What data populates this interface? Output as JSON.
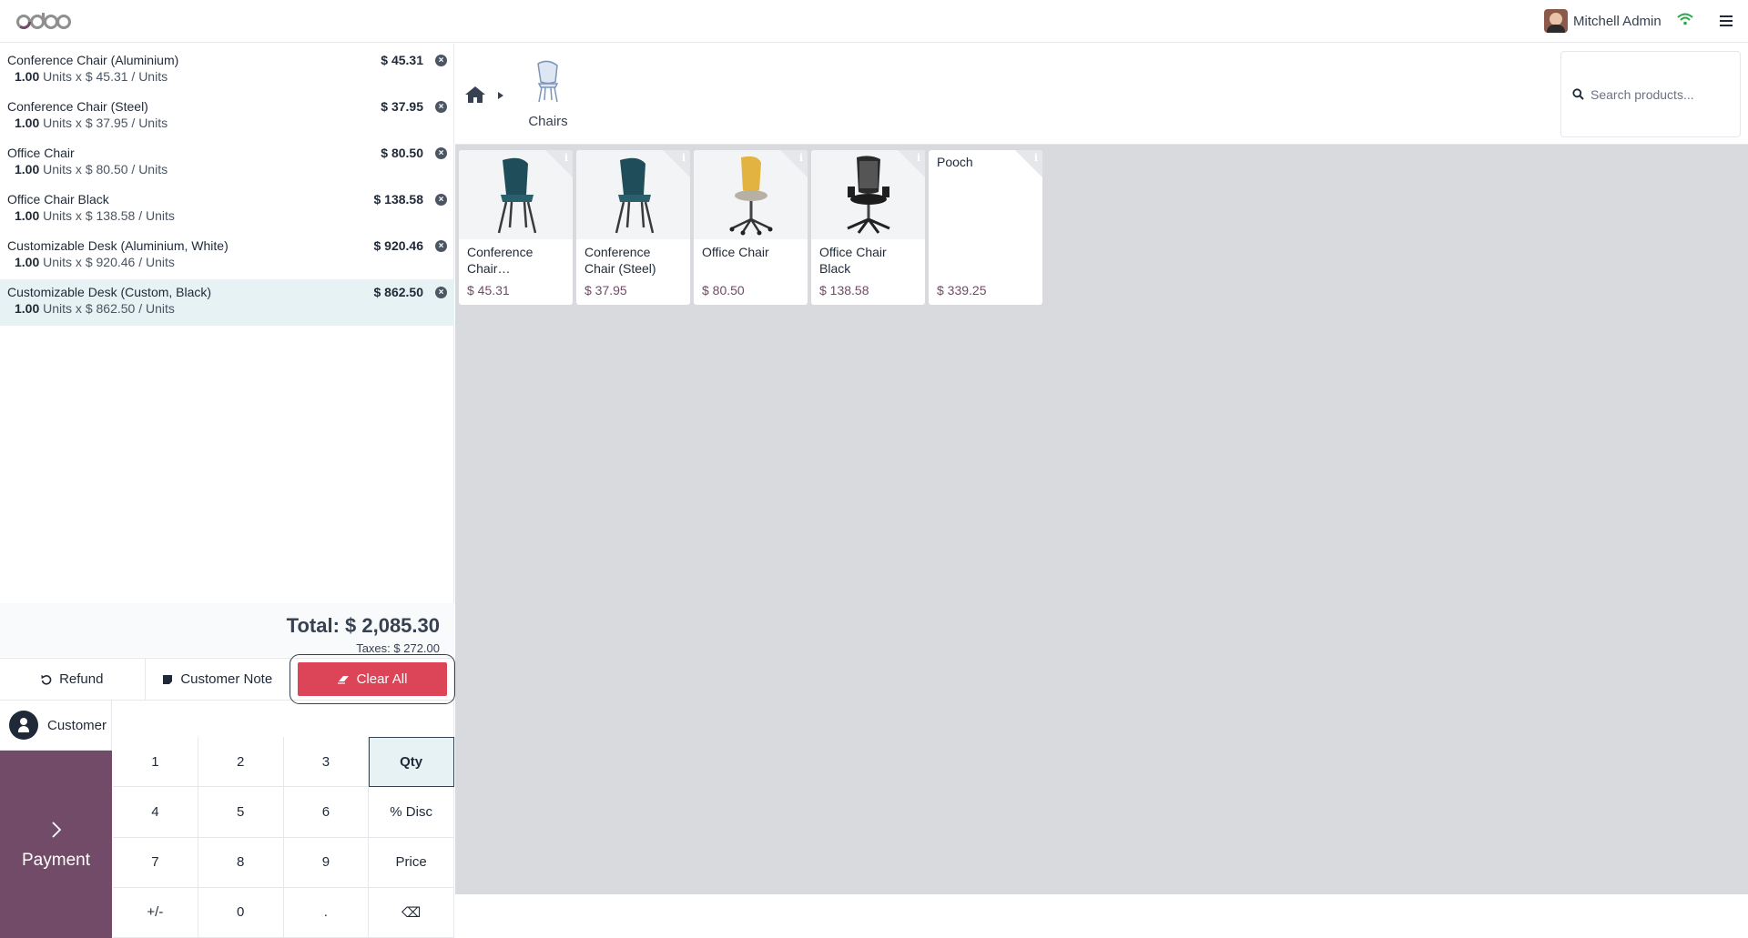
{
  "header": {
    "logo_text": "odoo",
    "user_name": "Mitchell Admin"
  },
  "order": {
    "lines": [
      {
        "name": "Conference Chair (Aluminium)",
        "price": "$ 45.31",
        "qty": "1.00",
        "detail": "Units x $ 45.31 / Units"
      },
      {
        "name": "Conference Chair (Steel)",
        "price": "$ 37.95",
        "qty": "1.00",
        "detail": "Units x $ 37.95 / Units"
      },
      {
        "name": "Office Chair",
        "price": "$ 80.50",
        "qty": "1.00",
        "detail": "Units x $ 80.50 / Units"
      },
      {
        "name": "Office Chair Black",
        "price": "$ 138.58",
        "qty": "1.00",
        "detail": "Units x $ 138.58 / Units"
      },
      {
        "name": "Customizable Desk (Aluminium, White)",
        "price": "$ 920.46",
        "qty": "1.00",
        "detail": "Units x $ 920.46 / Units"
      },
      {
        "name": "Customizable Desk (Custom, Black)",
        "price": "$ 862.50",
        "qty": "1.00",
        "detail": "Units x $ 862.50 / Units"
      }
    ],
    "selected_index": 5,
    "total": "Total: $ 2,085.30",
    "taxes": "Taxes: $ 272.00"
  },
  "actions": {
    "refund": "Refund",
    "customer_note": "Customer Note",
    "clear_all": "Clear All"
  },
  "customer_label": "Customer",
  "payment_label": "Payment",
  "numpad": [
    "1",
    "2",
    "3",
    "Qty",
    "4",
    "5",
    "6",
    "% Disc",
    "7",
    "8",
    "9",
    "Price",
    "+/-",
    "0",
    ".",
    "⌫"
  ],
  "numpad_active": "Qty",
  "breadcrumb": {
    "home_icon": "home-icon",
    "category": "Chairs"
  },
  "search": {
    "placeholder": "Search products..."
  },
  "products": [
    {
      "name": "Conference Chair…",
      "price": "$ 45.31",
      "image": "teal-chair"
    },
    {
      "name": "Conference Chair (Steel)",
      "price": "$ 37.95",
      "image": "teal-chair"
    },
    {
      "name": "Office Chair",
      "price": "$ 80.50",
      "image": "yellow-swivel-chair"
    },
    {
      "name": "Office Chair Black",
      "price": "$ 138.58",
      "image": "black-office-chair"
    },
    {
      "name": "Pooch",
      "price": "$ 339.25",
      "image": ""
    }
  ],
  "colors": {
    "brand": "#714b67",
    "danger": "#dc4458",
    "selected": "#e6f2f3"
  }
}
